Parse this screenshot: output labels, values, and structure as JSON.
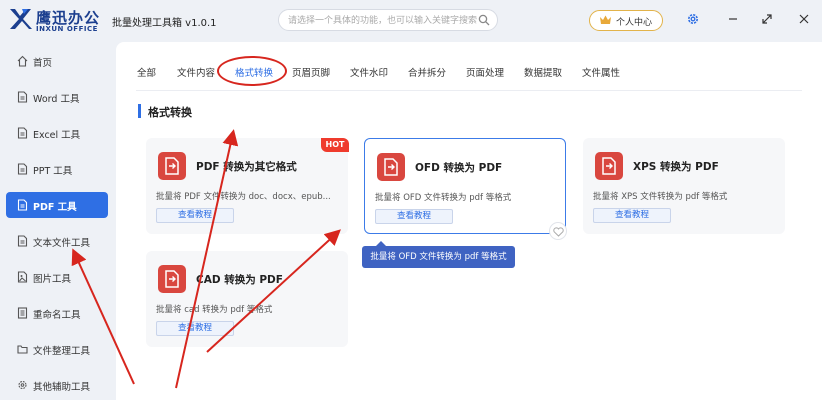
{
  "app": {
    "logo_cn": "鹰迅办公",
    "logo_en": "INXUN OFFICE",
    "title": "批量处理工具箱 v1.0.1"
  },
  "search": {
    "placeholder": "请选择一个具体的功能，也可以输入关键字搜索！"
  },
  "header": {
    "user_center": "个人中心",
    "icons": [
      "search-icon",
      "crown-icon",
      "settings-icon",
      "minimize-icon",
      "maximize-icon",
      "close-icon"
    ]
  },
  "sidebar": {
    "items": [
      {
        "label": "首页",
        "icon": "home-icon"
      },
      {
        "label": "Word 工具",
        "icon": "document-icon"
      },
      {
        "label": "Excel 工具",
        "icon": "document-icon"
      },
      {
        "label": "PPT 工具",
        "icon": "document-icon"
      },
      {
        "label": "PDF 工具",
        "icon": "document-icon",
        "active": true
      },
      {
        "label": "文本文件工具",
        "icon": "document-icon"
      },
      {
        "label": "图片工具",
        "icon": "image-icon"
      },
      {
        "label": "重命名工具",
        "icon": "list-icon"
      },
      {
        "label": "文件整理工具",
        "icon": "folder-icon"
      },
      {
        "label": "其他辅助工具",
        "icon": "gear-icon"
      }
    ]
  },
  "tabs": [
    {
      "label": "全部"
    },
    {
      "label": "文件内容"
    },
    {
      "label": "格式转换",
      "active": true
    },
    {
      "label": "页眉页脚"
    },
    {
      "label": "文件水印"
    },
    {
      "label": "合并拆分"
    },
    {
      "label": "页面处理"
    },
    {
      "label": "数据提取"
    },
    {
      "label": "文件属性"
    }
  ],
  "section": {
    "title": "格式转换"
  },
  "cards": [
    {
      "title": "PDF 转换为其它格式",
      "desc": "批量将 PDF 文件转换为 doc、docx、epub...",
      "button": "查看教程",
      "badge": "HOT"
    },
    {
      "title": "OFD 转换为 PDF",
      "desc": "批量将 OFD 文件转换为 pdf 等格式",
      "button": "查看教程"
    },
    {
      "title": "XPS 转换为 PDF",
      "desc": "批量将 XPS 文件转换为 pdf 等格式",
      "button": "查看教程"
    },
    {
      "title": "CAD 转换为 PDF",
      "desc": "批量将 cad 转换为 pdf 等格式",
      "button": "查看教程"
    }
  ],
  "tooltip": {
    "text": "批量将 OFD 文件转换为 pdf 等格式"
  },
  "colors": {
    "accent": "#2f6fe4",
    "hot": "#ef3b2d",
    "annotation": "#d7261e",
    "tooltip": "#3f63c2"
  }
}
